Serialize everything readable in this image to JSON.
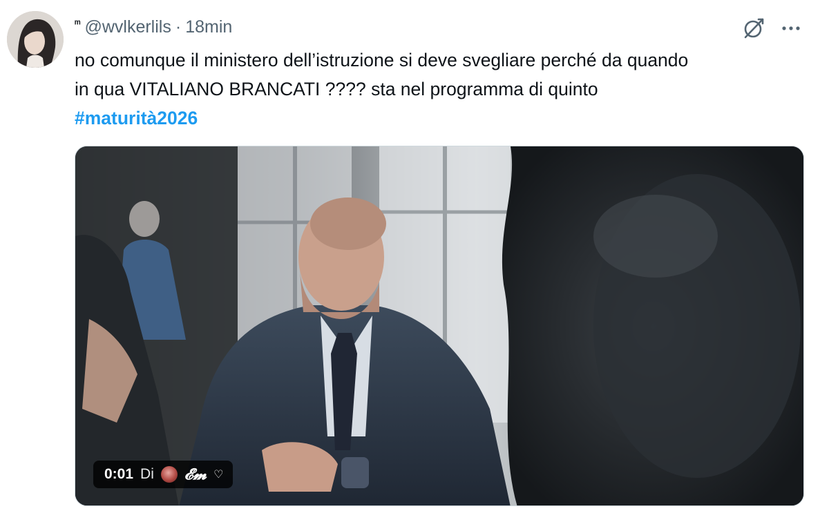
{
  "author": {
    "display_name": "ᵐ",
    "handle": "@wvlkerlils",
    "separator": "·",
    "time_ago": "18min"
  },
  "tweet": {
    "text_line_1": "no comunque il ministero dell’istruzione si deve svegliare perché da quando",
    "text_line_2": "in qua VITALIANO BRANCATI ???? sta nel programma di quinto",
    "hashtag": "#maturità2026"
  },
  "media": {
    "type": "video",
    "timestamp": "0:01",
    "via_label": "Di",
    "source_name": "𝓔𝓶",
    "source_suffix": "♡"
  },
  "icons": {
    "grok": "grok-icon",
    "more": "more-icon"
  },
  "colors": {
    "hashtag": "#1d9bf0",
    "secondary_text": "#536471",
    "primary_text": "#0f1419"
  }
}
